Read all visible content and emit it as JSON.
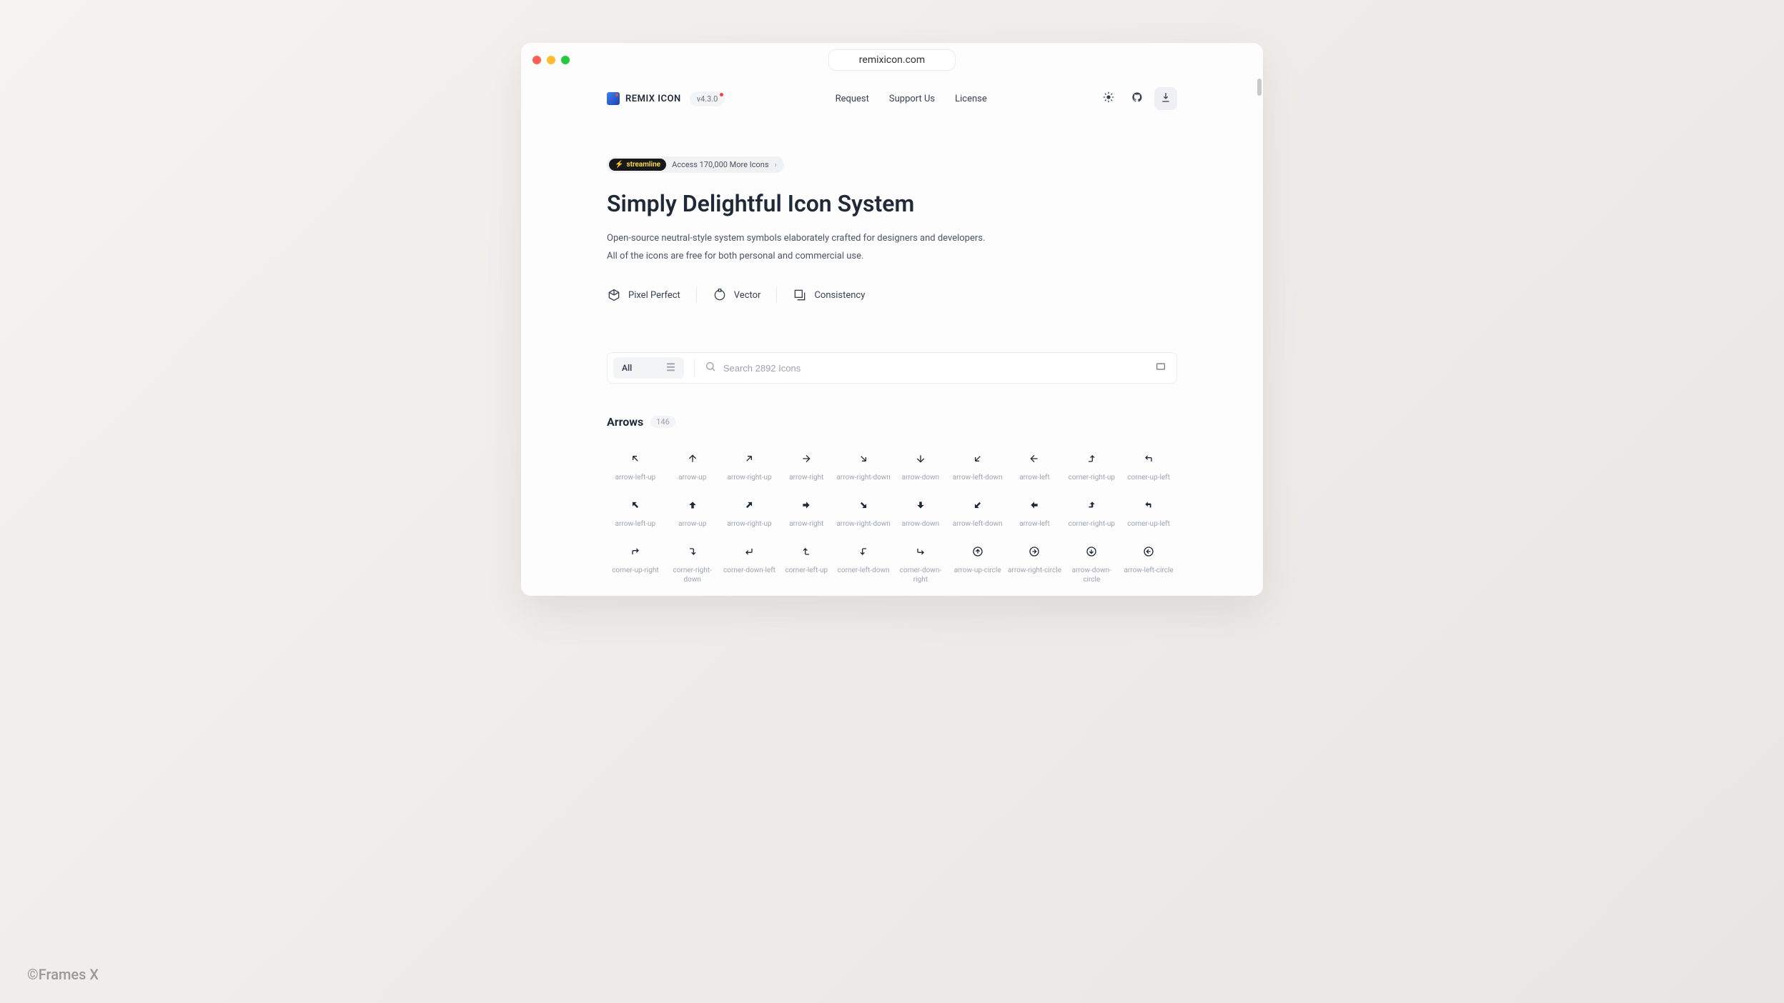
{
  "watermark": "©Frames X",
  "browser": {
    "url": "remixicon.com"
  },
  "header": {
    "brand": "REMIX ICON",
    "version": "v4.3.0",
    "nav": {
      "request": "Request",
      "support": "Support Us",
      "license": "License"
    }
  },
  "promo": {
    "pill": "streamline",
    "text": "Access 170,000 More Icons"
  },
  "hero": {
    "title": "Simply Delightful Icon System",
    "desc_line1": "Open-source neutral-style system symbols elaborately crafted for designers and developers.",
    "desc_line2": "All of the icons are free for both personal and commercial use."
  },
  "features": {
    "f1": "Pixel Perfect",
    "f2": "Vector",
    "f3": "Consistency"
  },
  "search": {
    "filter_label": "All",
    "placeholder": "Search 2892 Icons"
  },
  "category": {
    "title": "Arrows",
    "count": "146"
  },
  "icons": {
    "row1": [
      {
        "name": "arrow-left-up",
        "label": "arrow-left-up"
      },
      {
        "name": "arrow-up",
        "label": "arrow-up"
      },
      {
        "name": "arrow-right-up",
        "label": "arrow-right-up"
      },
      {
        "name": "arrow-right",
        "label": "arrow-right"
      },
      {
        "name": "arrow-right-down",
        "label": "arrow-right-down"
      },
      {
        "name": "arrow-down",
        "label": "arrow-down"
      },
      {
        "name": "arrow-left-down",
        "label": "arrow-left-down"
      },
      {
        "name": "arrow-left",
        "label": "arrow-left"
      },
      {
        "name": "corner-right-up",
        "label": "corner-right-up"
      },
      {
        "name": "corner-up-left",
        "label": "corner-up-left"
      }
    ],
    "row2": [
      {
        "name": "arrow-left-up-fill",
        "label": "arrow-left-up"
      },
      {
        "name": "arrow-up-fill",
        "label": "arrow-up"
      },
      {
        "name": "arrow-right-up-fill",
        "label": "arrow-right-up"
      },
      {
        "name": "arrow-right-fill",
        "label": "arrow-right"
      },
      {
        "name": "arrow-right-down-fill",
        "label": "arrow-right-down"
      },
      {
        "name": "arrow-down-fill",
        "label": "arrow-down"
      },
      {
        "name": "arrow-left-down-fill",
        "label": "arrow-left-down"
      },
      {
        "name": "arrow-left-fill",
        "label": "arrow-left"
      },
      {
        "name": "corner-right-up-fill",
        "label": "corner-right-up"
      },
      {
        "name": "corner-up-left-fill",
        "label": "corner-up-left"
      }
    ],
    "row3": [
      {
        "name": "corner-up-right",
        "label": "corner-up-right"
      },
      {
        "name": "corner-right-down",
        "label": "corner-right-down"
      },
      {
        "name": "corner-down-left",
        "label": "corner-down-left"
      },
      {
        "name": "corner-left-up",
        "label": "corner-left-up"
      },
      {
        "name": "corner-left-down",
        "label": "corner-left-down"
      },
      {
        "name": "corner-down-right",
        "label": "corner-down-right"
      },
      {
        "name": "arrow-up-circle",
        "label": "arrow-up-circle"
      },
      {
        "name": "arrow-right-circle",
        "label": "arrow-right-circle"
      },
      {
        "name": "arrow-down-circle",
        "label": "arrow-down-circle"
      },
      {
        "name": "arrow-left-circle",
        "label": "arrow-left-circle"
      }
    ]
  }
}
